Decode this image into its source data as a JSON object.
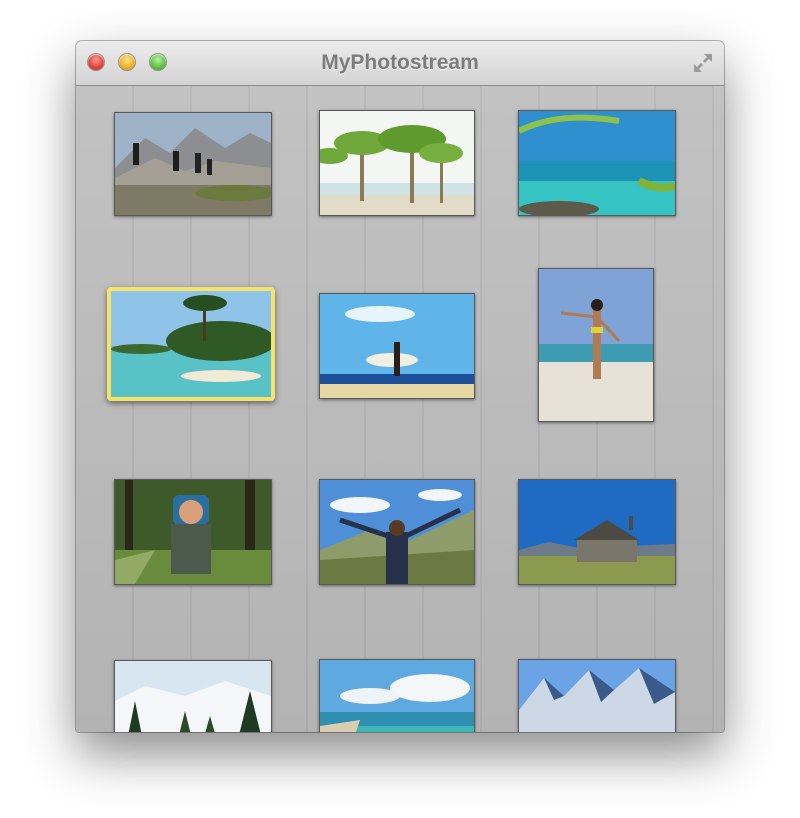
{
  "window": {
    "title": "MyPhotostream",
    "buttons": [
      "close",
      "minimize",
      "zoom"
    ],
    "fullscreen_icon": "expand-arrows-icon"
  },
  "grid": {
    "columns": 3,
    "selected_index": 3,
    "selection_color": "#f7e36a",
    "photos": [
      {
        "subject": "hikers-mountain"
      },
      {
        "subject": "palm-trees-beach"
      },
      {
        "subject": "tropical-sea-palm-leaves"
      },
      {
        "subject": "tropical-lagoon-island"
      },
      {
        "subject": "surfer-beach"
      },
      {
        "subject": "woman-beach"
      },
      {
        "subject": "backpacker-forest"
      },
      {
        "subject": "woman-arms-raised-valley"
      },
      {
        "subject": "stone-house-meadow"
      },
      {
        "subject": "snowy-mountain-forest"
      },
      {
        "subject": "coastline-clouds"
      },
      {
        "subject": "alpine-snow-peaks"
      }
    ]
  }
}
